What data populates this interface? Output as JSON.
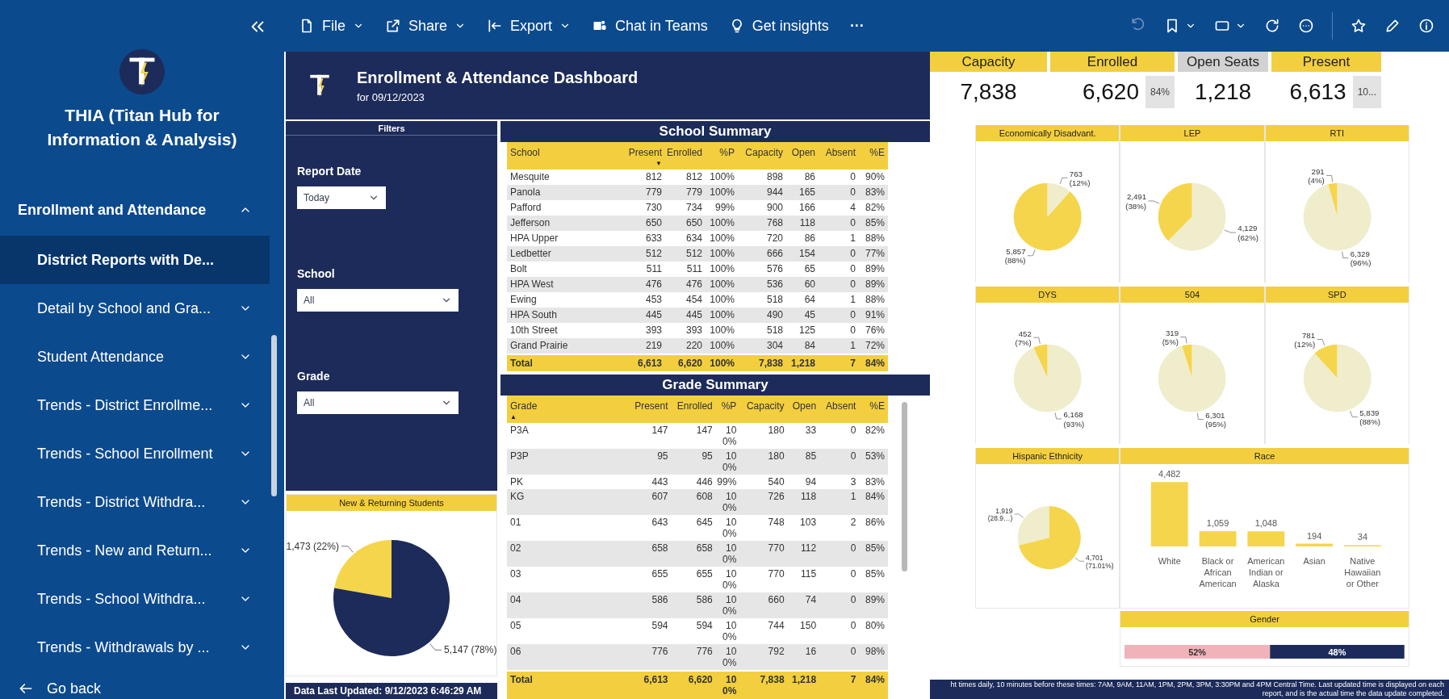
{
  "sidebar": {
    "title": "THIA (Titan Hub for Information & Analysis)",
    "section": {
      "label": "Enrollment and Attendance",
      "expanded": true
    },
    "items": [
      {
        "label": "District Reports with De...",
        "kind": "page",
        "selected": true
      },
      {
        "label": "Detail by School and Gra...",
        "kind": "group",
        "selected": false
      },
      {
        "label": "Student Attendance",
        "kind": "group",
        "selected": false
      },
      {
        "label": "Trends - District Enrollme...",
        "kind": "group",
        "selected": false
      },
      {
        "label": "Trends - School Enrollment",
        "kind": "group",
        "selected": false
      },
      {
        "label": "Trends - District Withdra...",
        "kind": "group",
        "selected": false
      },
      {
        "label": "Trends - New and Return...",
        "kind": "group",
        "selected": false
      },
      {
        "label": "Trends - School Withdra...",
        "kind": "group",
        "selected": false
      },
      {
        "label": "Trends - Withdrawals by ...",
        "kind": "group",
        "selected": false
      }
    ],
    "go_back": "Go back"
  },
  "toolbar": {
    "items": [
      {
        "label": "File",
        "dropdown": true
      },
      {
        "label": "Share",
        "dropdown": true
      },
      {
        "label": "Export",
        "dropdown": true
      },
      {
        "label": "Chat in Teams",
        "dropdown": false
      },
      {
        "label": "Get insights",
        "dropdown": false
      }
    ],
    "more": "···",
    "right_tools": [
      {
        "kind": "undo",
        "disabled": true,
        "dropdown": false
      },
      {
        "kind": "bookmark",
        "disabled": false,
        "dropdown": true
      },
      {
        "kind": "view",
        "disabled": false,
        "dropdown": true
      },
      {
        "kind": "refresh",
        "disabled": false,
        "dropdown": false
      },
      {
        "kind": "comment",
        "disabled": false,
        "dropdown": false
      },
      {
        "kind": "star",
        "disabled": false,
        "dropdown": false
      },
      {
        "kind": "edit",
        "disabled": false,
        "dropdown": false
      },
      {
        "kind": "info",
        "disabled": false,
        "dropdown": false
      }
    ]
  },
  "report_header": {
    "title": "Enrollment & Attendance Dashboard",
    "subtitle": "for 09/12/2023"
  },
  "kpis": [
    {
      "label": "Capacity",
      "value": "7,838",
      "muted": false
    },
    {
      "label": "Enrolled",
      "value": "6,620",
      "badge": "84%",
      "muted": false
    },
    {
      "label": "Open Seats",
      "value": "1,218",
      "muted": true
    },
    {
      "label": "Present",
      "value": "6,613",
      "badge": "10...",
      "muted": false
    }
  ],
  "filters": {
    "title": "Filters",
    "fields": [
      {
        "label": "Report Date",
        "value": "Today"
      },
      {
        "label": "School",
        "value": "All"
      },
      {
        "label": "Grade",
        "value": "All"
      }
    ]
  },
  "new_returning": {
    "title": "New & Returning Students",
    "chart_data": {
      "type": "pie",
      "values": [
        1473,
        5147
      ],
      "colors": [
        "#f5d54c",
        "#1c2b59"
      ],
      "value_labels": [
        "1,473 (22%)",
        "5,147 (78%)"
      ]
    }
  },
  "last_updated": "Data Last Updated: 9/12/2023 6:46:29 AM",
  "school_summary": {
    "title": "School Summary",
    "columns": [
      {
        "label": "School"
      },
      {
        "label": "Present",
        "sort_indicator": "▼"
      },
      {
        "label": "Enrolled"
      },
      {
        "label": "%P"
      },
      {
        "label": "Capacity"
      },
      {
        "label": "Open"
      },
      {
        "label": "Absent"
      },
      {
        "label": "%E"
      }
    ],
    "rows": [
      [
        "Mesquite",
        "812",
        "812",
        "100%",
        "898",
        "86",
        "0",
        "90%"
      ],
      [
        "Panola",
        "779",
        "779",
        "100%",
        "944",
        "165",
        "0",
        "83%"
      ],
      [
        "Pafford",
        "730",
        "734",
        "99%",
        "900",
        "166",
        "4",
        "82%"
      ],
      [
        "Jefferson",
        "650",
        "650",
        "100%",
        "768",
        "118",
        "0",
        "85%"
      ],
      [
        "HPA Upper",
        "633",
        "634",
        "100%",
        "720",
        "86",
        "1",
        "88%"
      ],
      [
        "Ledbetter",
        "512",
        "512",
        "100%",
        "666",
        "154",
        "0",
        "77%"
      ],
      [
        "Bolt",
        "511",
        "511",
        "100%",
        "576",
        "65",
        "0",
        "89%"
      ],
      [
        "HPA West",
        "476",
        "476",
        "100%",
        "536",
        "60",
        "0",
        "89%"
      ],
      [
        "Ewing",
        "453",
        "454",
        "100%",
        "518",
        "64",
        "1",
        "88%"
      ],
      [
        "HPA South",
        "445",
        "445",
        "100%",
        "490",
        "45",
        "0",
        "91%"
      ],
      [
        "10th Street",
        "393",
        "393",
        "100%",
        "518",
        "125",
        "0",
        "76%"
      ],
      [
        "Grand Prairie",
        "219",
        "220",
        "100%",
        "304",
        "84",
        "1",
        "72%"
      ]
    ],
    "total": [
      "Total",
      "6,613",
      "6,620",
      "100%",
      "7,838",
      "1,218",
      "7",
      "84%"
    ]
  },
  "grade_summary": {
    "title": "Grade Summary",
    "columns": [
      {
        "label": "Grade",
        "sort_indicator": "▲"
      },
      {
        "label": "Present"
      },
      {
        "label": "Enrolled"
      },
      {
        "label": "%P"
      },
      {
        "label": "Capacity"
      },
      {
        "label": "Open"
      },
      {
        "label": "Absent"
      },
      {
        "label": "%E"
      }
    ],
    "rows": [
      [
        "P3A",
        "147",
        "147",
        "100%",
        "180",
        "33",
        "0",
        "82%"
      ],
      [
        "P3P",
        "95",
        "95",
        "100%",
        "180",
        "85",
        "0",
        "53%"
      ],
      [
        "PK",
        "443",
        "446",
        "99%",
        "540",
        "94",
        "3",
        "83%"
      ],
      [
        "KG",
        "607",
        "608",
        "100%",
        "726",
        "118",
        "1",
        "84%"
      ],
      [
        "01",
        "643",
        "645",
        "100%",
        "748",
        "103",
        "2",
        "86%"
      ],
      [
        "02",
        "658",
        "658",
        "100%",
        "770",
        "112",
        "0",
        "85%"
      ],
      [
        "03",
        "655",
        "655",
        "100%",
        "770",
        "115",
        "0",
        "85%"
      ],
      [
        "04",
        "586",
        "586",
        "100%",
        "660",
        "74",
        "0",
        "89%"
      ],
      [
        "05",
        "594",
        "594",
        "100%",
        "744",
        "150",
        "0",
        "80%"
      ],
      [
        "06",
        "776",
        "776",
        "100%",
        "792",
        "16",
        "0",
        "98%"
      ]
    ],
    "total": [
      "Total",
      "6,613",
      "6,620",
      "100%",
      "7,838",
      "1,218",
      "7",
      "84%"
    ]
  },
  "demographics": [
    {
      "title": "Economically Disadvant.",
      "chart_data": {
        "type": "pie",
        "values": [
          5857,
          763
        ],
        "colors": [
          "#f5d54c",
          "#efedcc"
        ],
        "value_labels": [
          "5,857 (88%)",
          "763 (12%)"
        ]
      }
    },
    {
      "title": "LEP",
      "chart_data": {
        "type": "pie",
        "values": [
          2491,
          4129
        ],
        "colors": [
          "#f5d54c",
          "#efedcc"
        ],
        "value_labels": [
          "2,491 (38%)",
          "4,129 (62%)"
        ]
      }
    },
    {
      "title": "RTI",
      "chart_data": {
        "type": "pie",
        "values": [
          291,
          6329
        ],
        "colors": [
          "#f5d54c",
          "#efedcc"
        ],
        "value_labels": [
          "291 (4%)",
          "6,329 (96%)"
        ]
      }
    },
    {
      "title": "DYS",
      "chart_data": {
        "type": "pie",
        "values": [
          452,
          6168
        ],
        "colors": [
          "#f5d54c",
          "#efedcc"
        ],
        "value_labels": [
          "452 (7%)",
          "6,168 (93%)"
        ]
      }
    },
    {
      "title": "504",
      "chart_data": {
        "type": "pie",
        "values": [
          319,
          6301
        ],
        "colors": [
          "#f5d54c",
          "#efedcc"
        ],
        "value_labels": [
          "319 (5%)",
          "6,301 (95%)"
        ]
      }
    },
    {
      "title": "SPD",
      "chart_data": {
        "type": "pie",
        "values": [
          781,
          5839
        ],
        "colors": [
          "#f5d54c",
          "#efedcc"
        ],
        "value_labels": [
          "781 (12%)",
          "5,839 (88%)"
        ]
      }
    }
  ],
  "hispanic": {
    "title": "Hispanic Ethnicity",
    "chart_data": {
      "type": "pie",
      "values": [
        1919,
        4701
      ],
      "colors": [
        "#efedcc",
        "#f5d54c"
      ],
      "value_labels": [
        "1,919 (28.9…)",
        "4,701 (71.01%)"
      ]
    }
  },
  "race": {
    "title": "Race",
    "chart_data": {
      "type": "bar",
      "categories": [
        "White",
        "Black or African American",
        "American Indian or Alaska",
        "Asian",
        "Native Hawaiian or Other"
      ],
      "values": [
        4482,
        1059,
        1048,
        194,
        34
      ],
      "value_labels": [
        "4,482",
        "1,059",
        "1,048",
        "194",
        "34"
      ]
    }
  },
  "gender": {
    "title": "Gender",
    "chart_data": {
      "type": "bar",
      "orientation": "horizontal",
      "stacked": true,
      "series": [
        {
          "color": "#f0b3ba",
          "values": [
            52
          ],
          "value_labels": [
            "52%"
          ]
        },
        {
          "color": "#1c2b59",
          "values": [
            48
          ],
          "value_labels": [
            "48%"
          ]
        }
      ]
    }
  },
  "footer_note": "ht times daily, 10 minutes before these times: 7AM, 9AM, 11AM, 1PM, 2PM, 3PM, 3:30PM and 4PM Central Time. Last updated time is displayed on each report, and is the actual time the data update completed."
}
